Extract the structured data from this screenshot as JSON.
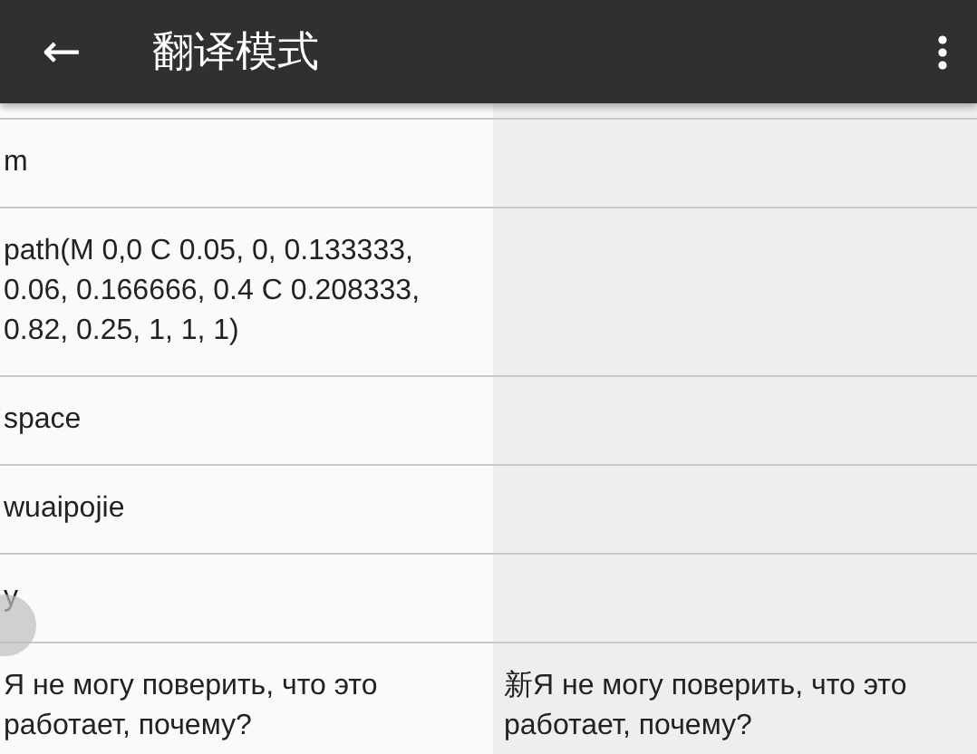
{
  "app_bar": {
    "back": "←",
    "title": "翻译模式"
  },
  "rows": [
    {
      "source": "m"
    },
    {
      "source": "path(M 0,0 C 0.05, 0, 0.133333, 0.06, 0.166666, 0.4 C 0.208333, 0.82, 0.25, 1, 1, 1)"
    },
    {
      "source": "space"
    },
    {
      "source": "wuaipojie"
    },
    {
      "source": "y"
    },
    {
      "source": "Я не могу поверить, что это работает, почему?",
      "translation": "新Я не могу поверить, что это работает, почему?"
    }
  ]
}
